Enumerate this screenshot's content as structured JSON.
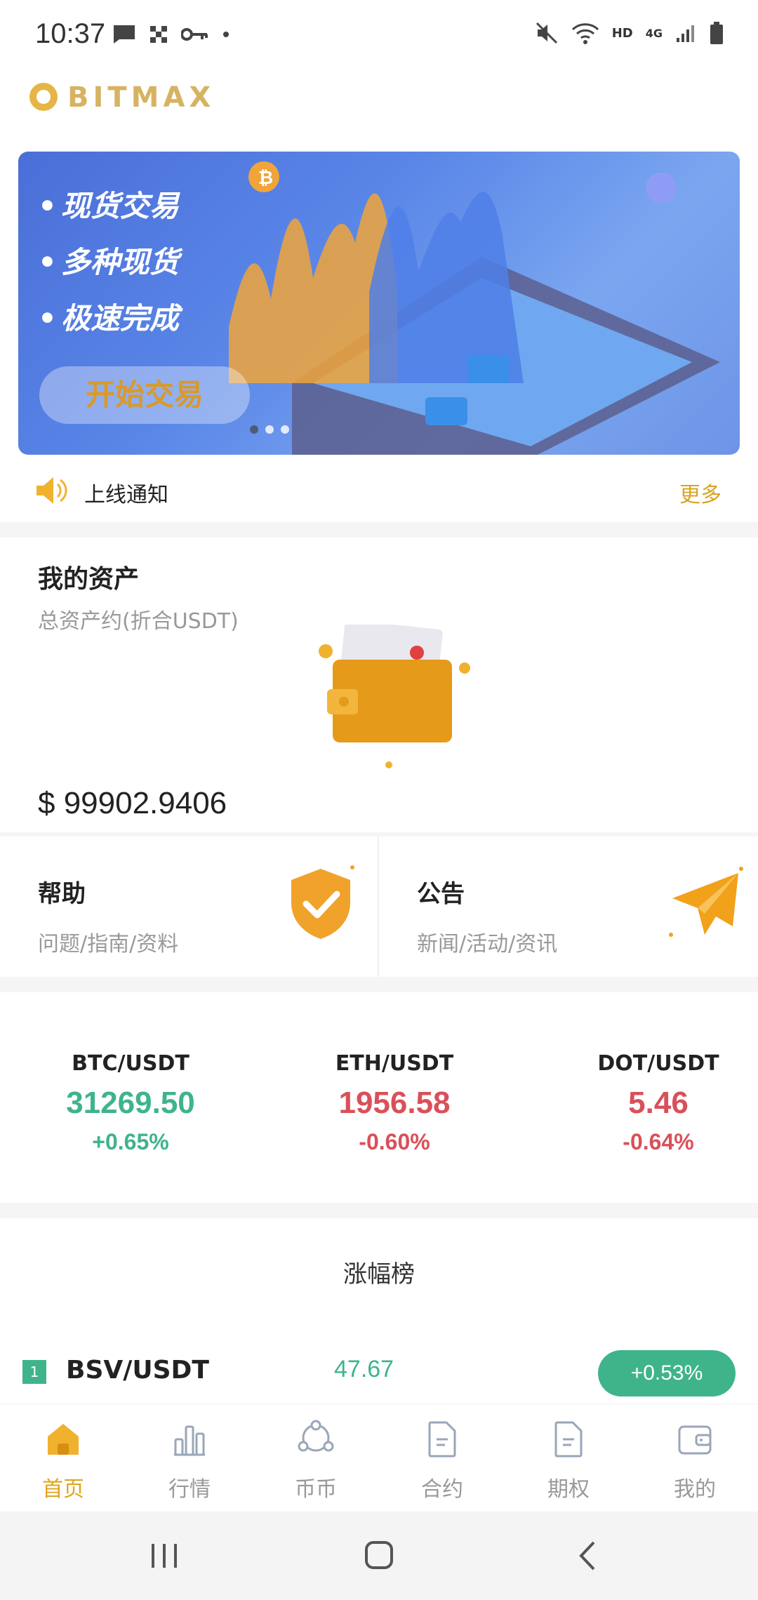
{
  "status_bar": {
    "time": "10:37",
    "network_hd": "HD",
    "network_4g": "4G"
  },
  "header": {
    "logo_text": "BITMAX"
  },
  "banner": {
    "lines": [
      "现货交易",
      "多种现货",
      "极速完成"
    ],
    "button_label": "开始交易",
    "page_count": 3,
    "active_page": 1
  },
  "notice": {
    "text": "上线通知",
    "more_label": "更多"
  },
  "assets": {
    "title": "我的资产",
    "subtitle": "总资产约(折合USDT)",
    "value": "$ 99902.9406"
  },
  "quick_cards": {
    "help": {
      "title": "帮助",
      "subtitle": "问题/指南/资料"
    },
    "announcement": {
      "title": "公告",
      "subtitle": "新闻/活动/资讯"
    }
  },
  "tickers": [
    {
      "pair": "BTC/USDT",
      "price": "31269.50",
      "change": "+0.65%",
      "trend": "up"
    },
    {
      "pair": "ETH/USDT",
      "price": "1956.58",
      "change": "-0.60%",
      "trend": "down"
    },
    {
      "pair": "DOT/USDT",
      "price": "5.46",
      "change": "-0.64%",
      "trend": "down"
    }
  ],
  "gainers": {
    "title": "涨幅榜",
    "rows": [
      {
        "rank": "1",
        "pair": "BSV/USDT",
        "price": "47.67",
        "change": "+0.53%"
      }
    ]
  },
  "bottom_nav": {
    "items": [
      {
        "label": "首页",
        "icon": "home-icon",
        "active": true
      },
      {
        "label": "行情",
        "icon": "chart-icon",
        "active": false
      },
      {
        "label": "币币",
        "icon": "exchange-icon",
        "active": false
      },
      {
        "label": "合约",
        "icon": "document-icon",
        "active": false
      },
      {
        "label": "期权",
        "icon": "options-icon",
        "active": false
      },
      {
        "label": "我的",
        "icon": "wallet-icon",
        "active": false
      }
    ]
  },
  "colors": {
    "accent": "#e2a41a",
    "up": "#3fb48a",
    "down": "#d9505a",
    "banner": "#5a86e8"
  }
}
